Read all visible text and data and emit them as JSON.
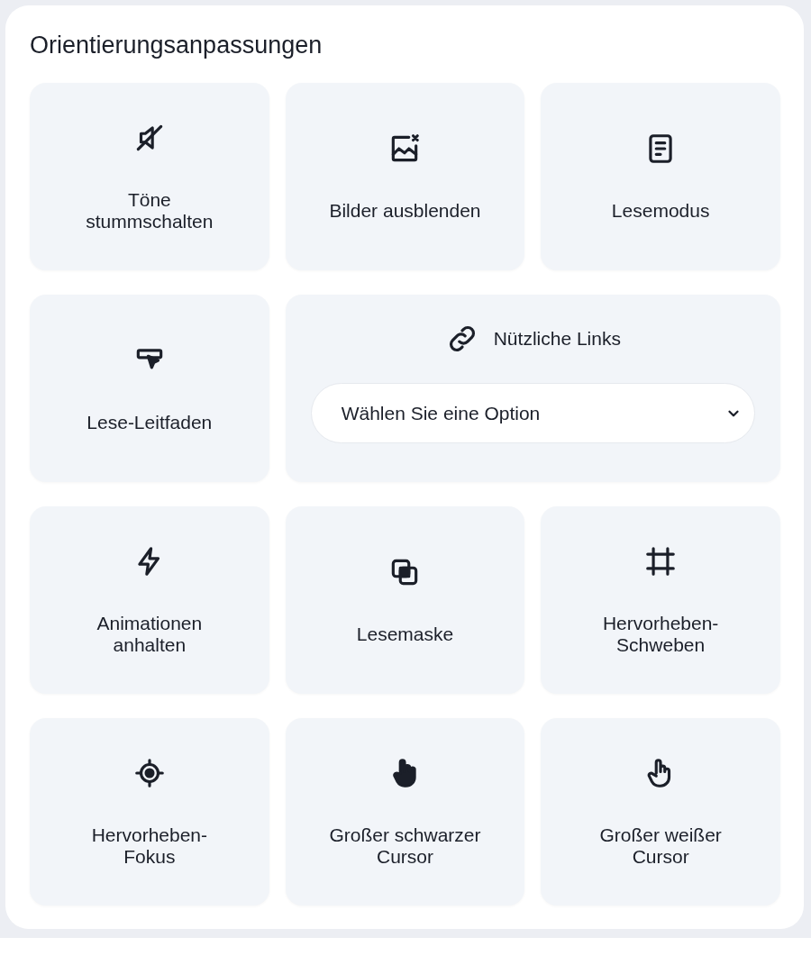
{
  "panel": {
    "title": "Orientierungsanpassungen"
  },
  "tiles": [
    {
      "kind": "toggle",
      "label": "Töne\nstummschalten"
    },
    {
      "kind": "toggle",
      "label": "Bilder ausblenden"
    },
    {
      "kind": "toggle",
      "label": "Lesemodus"
    },
    {
      "kind": "toggle",
      "label": "Lese-Leitfaden"
    },
    {
      "kind": "links",
      "label": "Nützliche Links",
      "select": {
        "value": "Wählen Sie eine Option"
      }
    },
    {
      "kind": "toggle",
      "label": "Animationen\nanhalten"
    },
    {
      "kind": "toggle",
      "label": "Lesemaske"
    },
    {
      "kind": "toggle",
      "label": "Hervorheben-\nSchweben"
    },
    {
      "kind": "toggle",
      "label": "Hervorheben-\nFokus"
    },
    {
      "kind": "toggle",
      "label": "Großer schwarzer\nCursor"
    },
    {
      "kind": "toggle",
      "label": "Großer weißer\nCursor"
    }
  ]
}
